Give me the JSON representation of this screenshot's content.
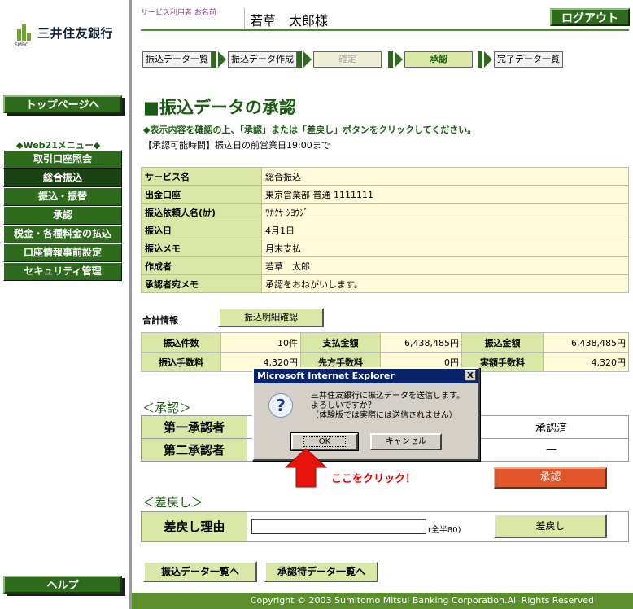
{
  "brand": {
    "name": "三井住友銀行",
    "sub": "SMBC"
  },
  "header": {
    "service_user_label": "サービス利用者 お名前",
    "user_name": "若草　太郎様",
    "logout": "ログアウト"
  },
  "sidebar": {
    "top_page": "トップページへ",
    "menu_title": "◆Web21メニュー◆",
    "items": [
      {
        "label": "取引口座照会"
      },
      {
        "label": "総合振込"
      },
      {
        "label": "振込・振替"
      },
      {
        "label": "承認"
      },
      {
        "label": "税金・各種料金の払込"
      },
      {
        "label": "口座情報事前設定"
      },
      {
        "label": "セキュリティ管理"
      }
    ],
    "help": "ヘルプ"
  },
  "steps": [
    "振込データ一覧",
    "振込データ作成",
    "確定",
    "承認",
    "完了データ一覧"
  ],
  "page": {
    "title": "■振込データの承認",
    "instruction": "◆表示内容を確認の上、「承認」または「差戻し」ボタンをクリックしてください。",
    "hours": "【承認可能時間】振込日の前営業日19:00まで"
  },
  "details": [
    {
      "label": "サービス名",
      "value": "総合振込"
    },
    {
      "label": "出金口座",
      "value": "東京営業部 普通 1111111"
    },
    {
      "label": "振込依頼人名(ｶﾅ)",
      "value": "ﾜｶｸｻ ｼﾖｳｼﾞ"
    },
    {
      "label": "振込日",
      "value": "4月1日"
    },
    {
      "label": "振込メモ",
      "value": "月末支払"
    },
    {
      "label": "作成者",
      "value": "若草　太郎"
    },
    {
      "label": "承認者宛メモ",
      "value": "承認をおねがいします。"
    }
  ],
  "summary": {
    "label": "合計情報",
    "detail_button": "振込明細確認",
    "rows": [
      [
        {
          "k": "振込件数",
          "v": "10件"
        },
        {
          "k": "支払金額",
          "v": "6,438,485円"
        },
        {
          "k": "振込金額",
          "v": "6,438,485円"
        }
      ],
      [
        {
          "k": "振込手数料",
          "v": "4,320円"
        },
        {
          "k": "先方手数料",
          "v": "0円"
        },
        {
          "k": "実額手数料",
          "v": "4,320円"
        }
      ]
    ]
  },
  "approval": {
    "heading": "＜承認＞",
    "approvers": [
      {
        "label": "第一承認者",
        "name": "",
        "status": "承認済"
      },
      {
        "label": "第二承認者",
        "name": "",
        "status": "—"
      }
    ],
    "approve_button": "承認"
  },
  "reject": {
    "heading": "＜差戻し＞",
    "label": "差戻し理由",
    "value": "",
    "hint": "(全半80)",
    "button": "差戻し"
  },
  "bottom": {
    "list_button": "振込データ一覧へ",
    "pending_button": "承認待データ一覧へ"
  },
  "footer": "Copyright © 2003 Sumitomo Mitsui Banking Corporation.All Rights Reserved",
  "dialog": {
    "title": "Microsoft Internet Explorer",
    "close": "X",
    "message_1": "三井住友銀行に振込データを送信します。",
    "message_2": "よろしいですか？",
    "message_3": "（体験版では実際には送信されません）",
    "ok": "OK",
    "cancel": "キャンセル"
  },
  "annotation": "ここをクリック！"
}
